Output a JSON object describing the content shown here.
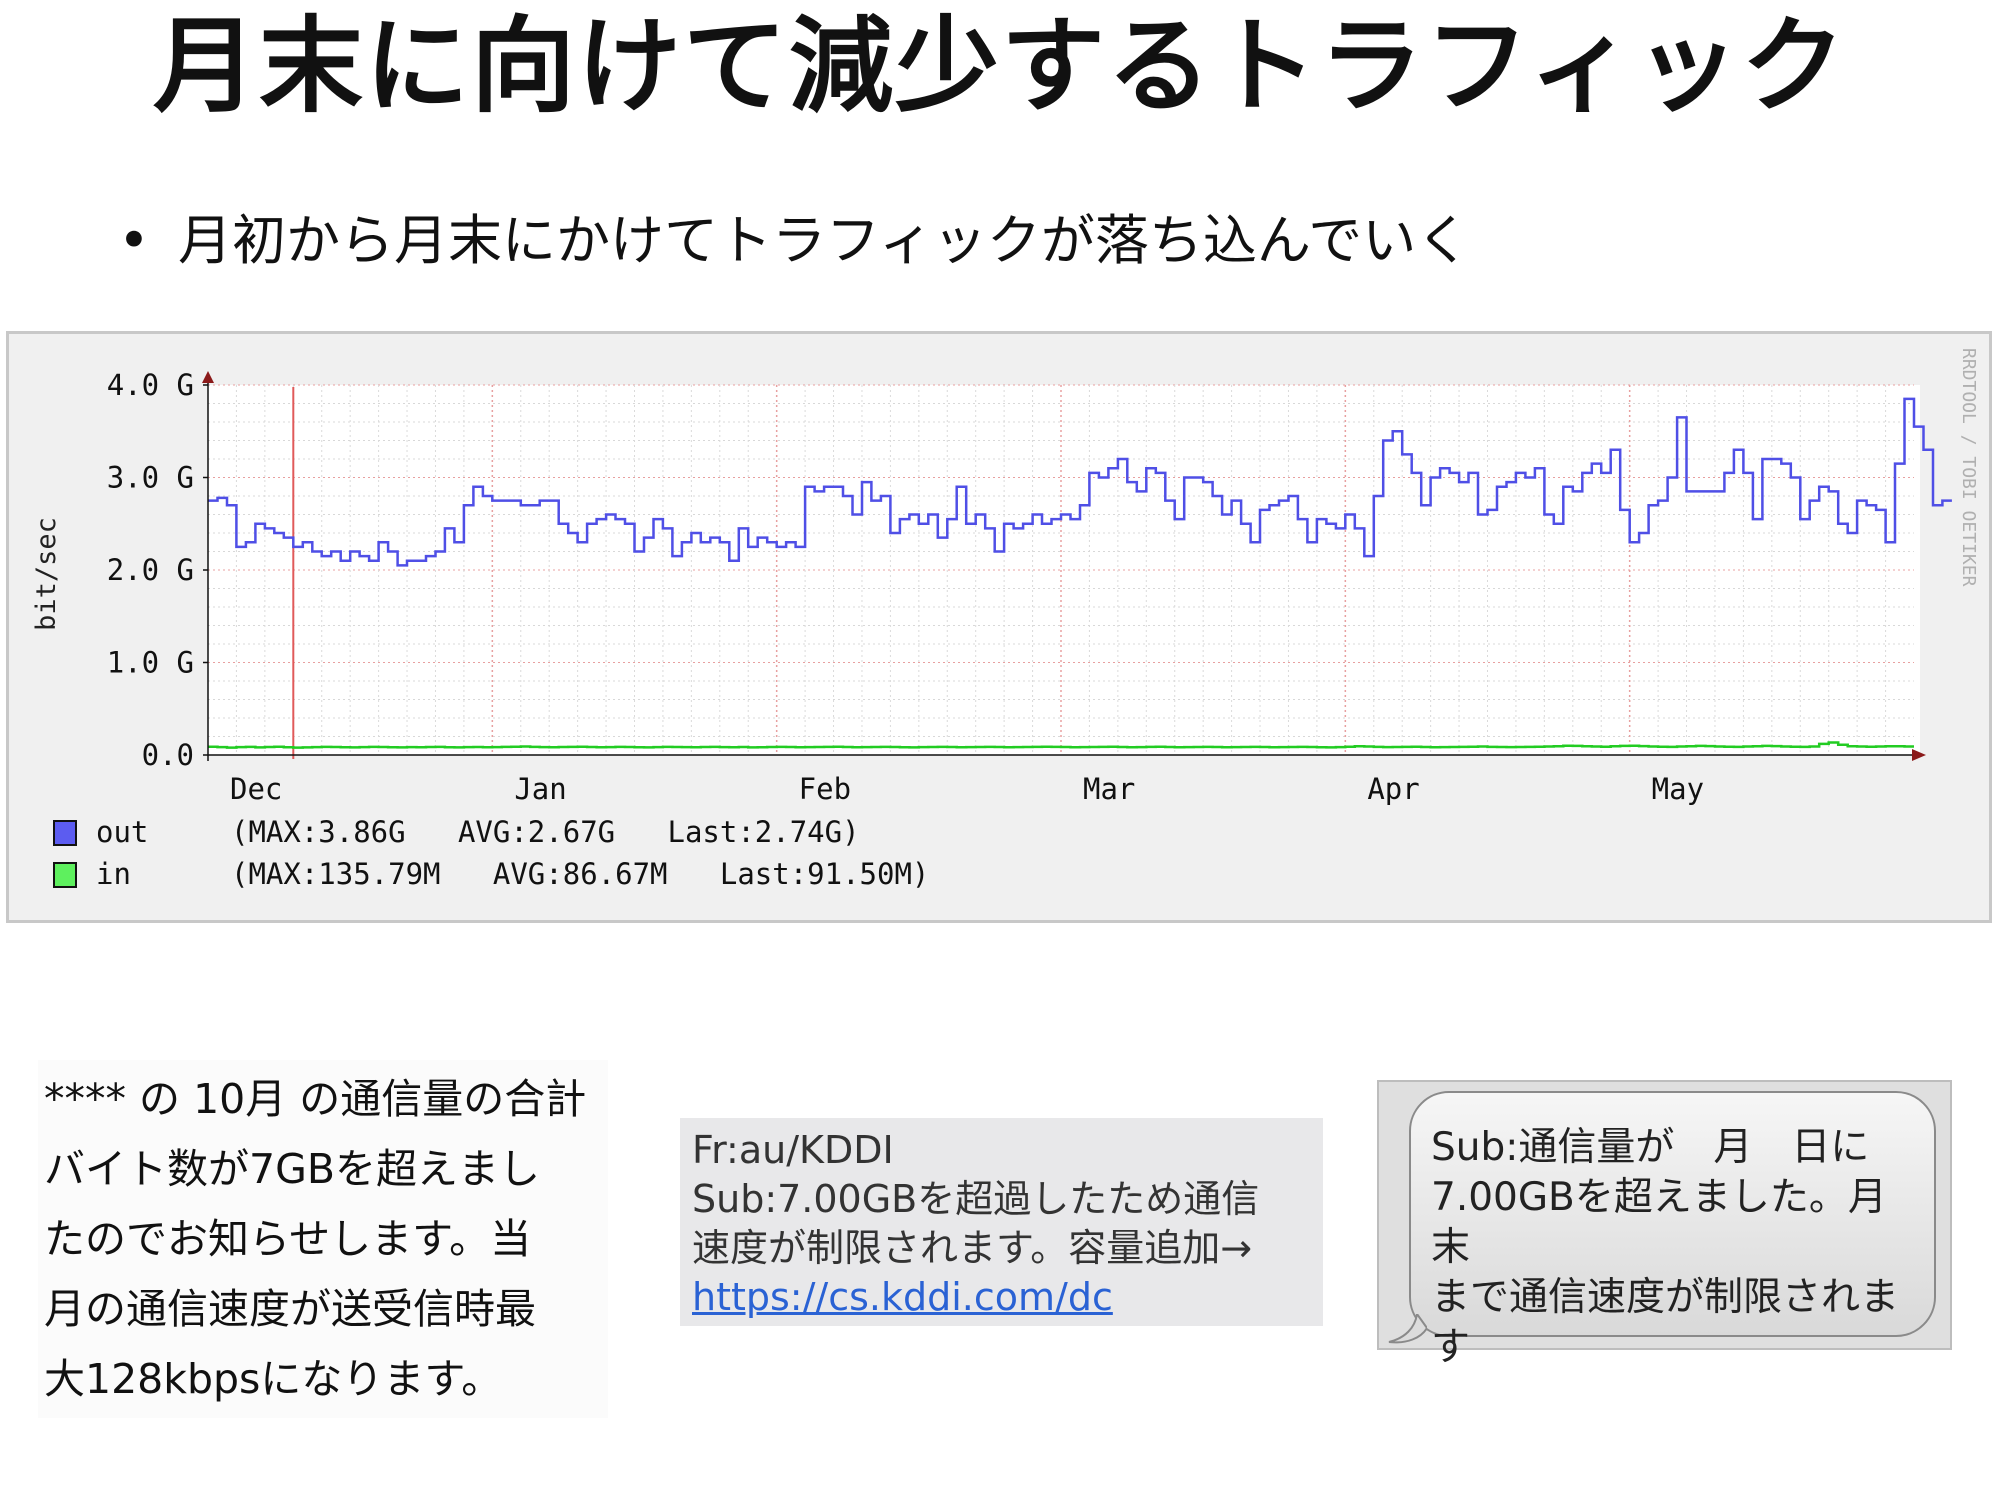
{
  "slide": {
    "title": "月末に向けて減少するトラフィック",
    "bullet": "月初から月末にかけてトラフィックが落ち込んでいく"
  },
  "chart_data": {
    "type": "line",
    "ylabel": "bit/sec",
    "watermark": "RRDTOOL / TOBI OETIKER",
    "y_ticks": [
      "0.0",
      "1.0 G",
      "2.0 G",
      "3.0 G",
      "4.0 G"
    ],
    "ylim": [
      0,
      4.0
    ],
    "x_months": [
      "Dec",
      "Jan",
      "Feb",
      "Mar",
      "Apr",
      "May"
    ],
    "grid": true,
    "series_color_out": "#4f4fe6",
    "series_color_in": "#22cc22",
    "marker_color": "#e05a5a",
    "marker_x": 9,
    "x_count": 180,
    "series": [
      {
        "name": "out",
        "unit": "G bit/sec",
        "values": [
          2.75,
          2.78,
          2.7,
          2.25,
          2.3,
          2.5,
          2.45,
          2.4,
          2.35,
          2.25,
          2.3,
          2.2,
          2.15,
          2.2,
          2.1,
          2.2,
          2.15,
          2.1,
          2.3,
          2.2,
          2.05,
          2.1,
          2.1,
          2.15,
          2.2,
          2.45,
          2.3,
          2.7,
          2.9,
          2.8,
          2.75,
          2.75,
          2.75,
          2.7,
          2.7,
          2.75,
          2.75,
          2.5,
          2.4,
          2.3,
          2.5,
          2.55,
          2.6,
          2.55,
          2.5,
          2.2,
          2.35,
          2.55,
          2.45,
          2.15,
          2.3,
          2.4,
          2.3,
          2.35,
          2.3,
          2.1,
          2.45,
          2.25,
          2.35,
          2.3,
          2.25,
          2.3,
          2.25,
          2.9,
          2.85,
          2.9,
          2.9,
          2.8,
          2.6,
          2.95,
          2.75,
          2.8,
          2.4,
          2.55,
          2.6,
          2.5,
          2.6,
          2.35,
          2.55,
          2.9,
          2.5,
          2.6,
          2.45,
          2.2,
          2.5,
          2.45,
          2.5,
          2.6,
          2.5,
          2.55,
          2.6,
          2.55,
          2.7,
          3.05,
          3.0,
          3.1,
          3.2,
          2.95,
          2.85,
          3.1,
          3.05,
          2.75,
          2.55,
          3.0,
          3.0,
          2.95,
          2.8,
          2.6,
          2.75,
          2.5,
          2.3,
          2.65,
          2.7,
          2.75,
          2.8,
          2.55,
          2.3,
          2.55,
          2.5,
          2.45,
          2.6,
          2.45,
          2.15,
          2.8,
          3.4,
          3.5,
          3.25,
          3.05,
          2.7,
          3.0,
          3.1,
          3.05,
          2.95,
          3.05,
          2.6,
          2.65,
          2.9,
          2.95,
          3.05,
          3.0,
          3.1,
          2.6,
          2.5,
          2.9,
          2.85,
          3.05,
          3.15,
          3.05,
          3.3,
          2.65,
          2.3,
          2.4,
          2.7,
          2.75,
          3.0,
          3.65,
          2.85,
          2.85,
          2.85,
          2.85,
          3.05,
          3.3,
          3.05,
          2.55,
          3.2,
          3.2,
          3.15,
          3.0,
          2.55,
          2.75,
          2.9,
          2.85,
          2.5,
          2.4,
          2.75,
          2.7,
          2.65,
          2.3,
          3.15,
          3.85,
          3.55,
          3.3,
          2.7,
          2.75
        ]
      },
      {
        "name": "in",
        "unit": "M bit/sec",
        "values": [
          90,
          85,
          80,
          85,
          88,
          82,
          86,
          90,
          84,
          80,
          82,
          85,
          88,
          86,
          84,
          82,
          85,
          88,
          86,
          84,
          82,
          85,
          83,
          86,
          88,
          84,
          82,
          85,
          86,
          84,
          85,
          88,
          90,
          92,
          88,
          85,
          84,
          86,
          88,
          90,
          86,
          84,
          85,
          88,
          86,
          84,
          82,
          85,
          88,
          86,
          85,
          84,
          86,
          88,
          85,
          84,
          86,
          82,
          84,
          86,
          88,
          86,
          84,
          85,
          86,
          88,
          90,
          86,
          84,
          85,
          86,
          88,
          86,
          84,
          82,
          85,
          86,
          88,
          86,
          84,
          85,
          86,
          88,
          86,
          84,
          85,
          86,
          88,
          90,
          88,
          86,
          84,
          85,
          86,
          88,
          90,
          86,
          84,
          85,
          88,
          90,
          86,
          84,
          85,
          86,
          88,
          86,
          84,
          85,
          86,
          88,
          86,
          84,
          85,
          86,
          88,
          86,
          84,
          82,
          85,
          90,
          95,
          92,
          88,
          85,
          86,
          88,
          90,
          86,
          84,
          85,
          86,
          88,
          90,
          92,
          88,
          86,
          85,
          86,
          88,
          90,
          92,
          95,
          100,
          98,
          95,
          92,
          90,
          95,
          98,
          100,
          96,
          92,
          90,
          88,
          92,
          95,
          98,
          96,
          92,
          90,
          88,
          92,
          95,
          98,
          96,
          92,
          90,
          88,
          92,
          120,
          135,
          110,
          95,
          92,
          90,
          92,
          95,
          94,
          92
        ]
      }
    ],
    "legend": [
      {
        "label": "out",
        "stats": "(MAX:3.86G   AVG:2.67G   Last:2.74G)"
      },
      {
        "label": "in",
        "stats": "(MAX:135.79M   AVG:86.67M   Last:91.50M)"
      }
    ]
  },
  "panel_a": {
    "lines": [
      "**** の 10月 の通信量の合計",
      "バイト数が7GBを超えまし",
      "たのでお知らせします。当",
      "月の通信速度が送受信時最",
      "大128kbpsになります。"
    ]
  },
  "panel_b": {
    "line1": "Fr:au/KDDI",
    "line2": "Sub:7.00GBを超過したため通信",
    "line3": "速度が制限されます。容量追加→",
    "link": "https://cs.kddi.com/dc"
  },
  "panel_c": {
    "lines": [
      "Sub:通信量が　月　日に",
      "7.00GBを超えました。月末",
      "まで通信速度が制限されま",
      "す"
    ]
  }
}
